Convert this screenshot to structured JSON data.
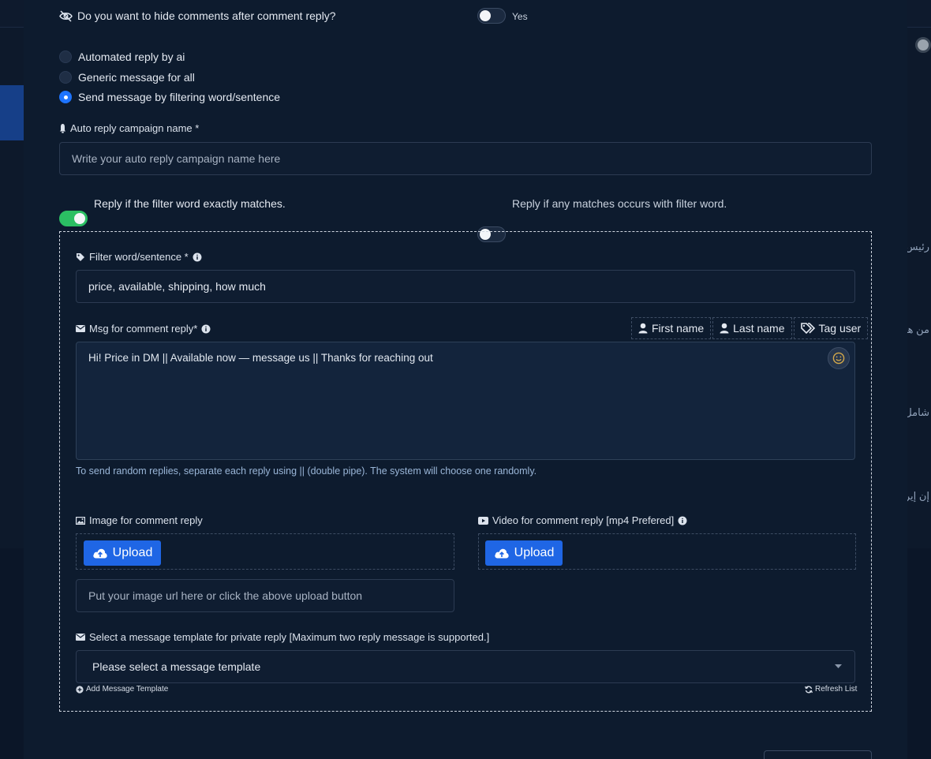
{
  "background": {
    "right_items": [
      "رئيس",
      "من هو",
      "شامل",
      "إن إير"
    ]
  },
  "hide_comments": {
    "label": "Do you want to hide comments after comment reply?",
    "toggle_label": "Yes"
  },
  "reply_modes": [
    {
      "label": "Automated reply by ai",
      "selected": false
    },
    {
      "label": "Generic message for all",
      "selected": false
    },
    {
      "label": "Send message by filtering word/sentence",
      "selected": true
    }
  ],
  "campaign": {
    "label": "Auto reply campaign name *",
    "placeholder": "Write your auto reply campaign name here"
  },
  "match_options": {
    "exact_label": "Reply if the filter word exactly matches.",
    "any_label": "Reply if any matches occurs with filter word."
  },
  "filter": {
    "label": "Filter word/sentence *",
    "value": "price, available, shipping, how much"
  },
  "message": {
    "label": "Msg for comment reply*",
    "tags": [
      "First name",
      "Last name",
      "Tag user"
    ],
    "value": "Hi! Price in DM || Available now — message us || Thanks for reaching out",
    "hint": "To send random replies, separate each reply using || (double pipe). The system will choose one randomly."
  },
  "image": {
    "label": "Image for comment reply",
    "upload_label": "Upload",
    "url_placeholder": "Put your image url here or click the above upload button"
  },
  "video": {
    "label": "Video for comment reply [mp4 Prefered]",
    "upload_label": "Upload"
  },
  "template": {
    "label": "Select a message template for private reply [Maximum two reply message is supported.]",
    "selected": "Please select a message template",
    "add_label": "Add Message Template",
    "refresh_label": "Refresh List"
  },
  "colors": {
    "accent": "#1f66e5",
    "toggle_on": "#2bbf63",
    "modal_bg": "#0d1b2e"
  }
}
